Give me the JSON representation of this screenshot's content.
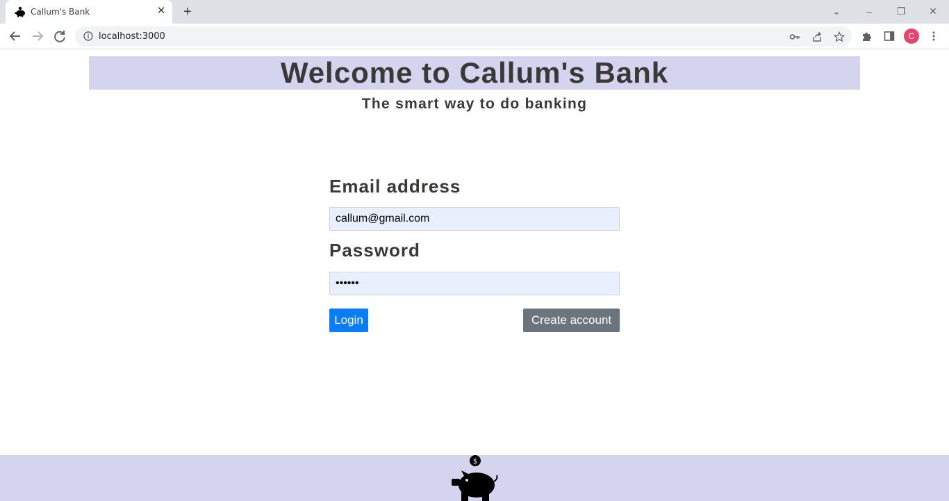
{
  "browser": {
    "tab_title": "Callum's Bank",
    "url": "localhost:3000",
    "profile_initial": "C"
  },
  "page": {
    "heading": "Welcome to Callum's Bank",
    "tagline": "The smart way to do banking",
    "form": {
      "email_label": "Email address",
      "email_value": "callum@gmail.com",
      "password_label": "Password",
      "password_value": "••••••",
      "login_label": "Login",
      "create_label": "Create account"
    }
  },
  "colors": {
    "banner_bg": "#d4d4ee",
    "primary_button": "#0a7cf5",
    "secondary_button": "#6c757d",
    "input_bg": "#e8f0fe"
  }
}
